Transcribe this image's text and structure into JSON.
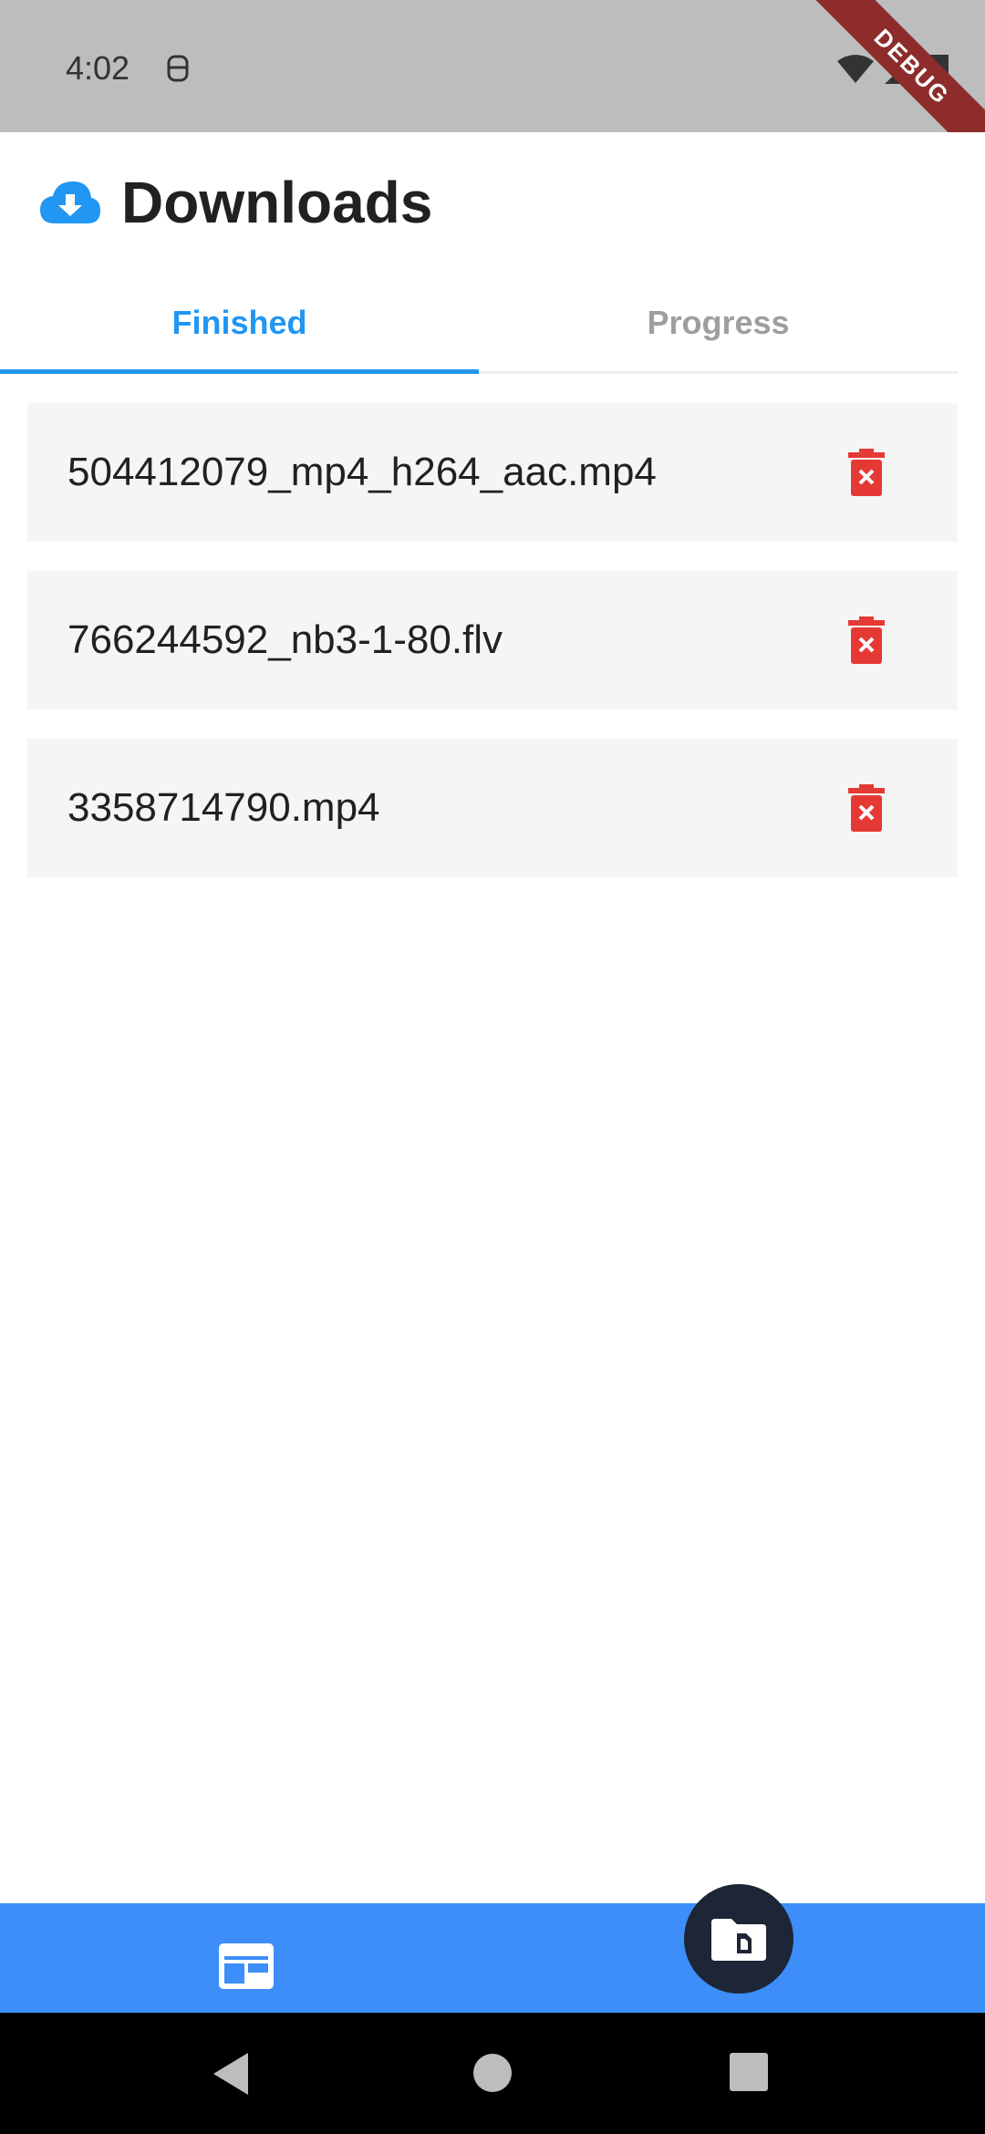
{
  "status_bar": {
    "time": "4:02",
    "debug_label": "DEBUG"
  },
  "header": {
    "title": "Downloads",
    "icon": "cloud-download-icon",
    "accent_color": "#2196f3"
  },
  "tabs": [
    {
      "label": "Finished",
      "active": true
    },
    {
      "label": "Progress",
      "active": false
    }
  ],
  "downloads": [
    {
      "name": "504412079_mp4_h264_aac.mp4"
    },
    {
      "name": "766244592_nb3-1-80.flv"
    },
    {
      "name": "3358714790.mp4"
    }
  ],
  "bottom_bar": {
    "color": "#3d8ef8",
    "left_icon": "web-layout-icon",
    "fab_icon": "folder-file-icon",
    "fab_color": "#1d2636"
  },
  "delete_color": "#e53935"
}
